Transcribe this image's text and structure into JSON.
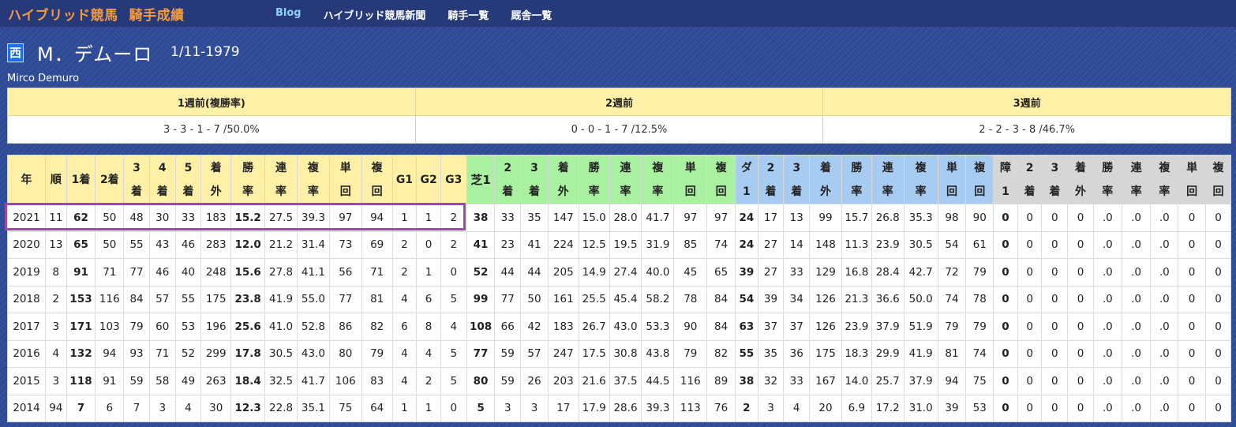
{
  "header": {
    "brand_main": "ハイブリッド競馬",
    "brand_sub": "騎手成績",
    "nav": [
      "Blog",
      "ハイブリッド競馬新聞",
      "騎手一覧",
      "厩舎一覧"
    ]
  },
  "jockey": {
    "affiliation": "西",
    "name": "M．デムーロ",
    "dob": "1/11-1979",
    "name_roman": "Mirco Demuro"
  },
  "recent_weeks": {
    "headers": [
      "1週前(複勝率)",
      "2週前",
      "3週前"
    ],
    "values": [
      "3 - 3 - 1 - 7 /50.0%",
      "0 - 0 - 1 - 7 /12.5%",
      "2 - 2 - 3 - 8 /46.7%"
    ]
  },
  "stats_table": {
    "headers": [
      [
        "年"
      ],
      [
        "順"
      ],
      [
        "1着"
      ],
      [
        "2着"
      ],
      [
        "3",
        "着"
      ],
      [
        "4",
        "着"
      ],
      [
        "5",
        "着"
      ],
      [
        "着",
        "外"
      ],
      [
        "勝",
        "率"
      ],
      [
        "連",
        "率"
      ],
      [
        "複",
        "率"
      ],
      [
        "単",
        "回"
      ],
      [
        "複",
        "回"
      ],
      [
        "G1"
      ],
      [
        "G2"
      ],
      [
        "G3"
      ],
      [
        "芝1"
      ],
      [
        "2",
        "着"
      ],
      [
        "3",
        "着"
      ],
      [
        "着",
        "外"
      ],
      [
        "勝",
        "率"
      ],
      [
        "連",
        "率"
      ],
      [
        "複",
        "率"
      ],
      [
        "単",
        "回"
      ],
      [
        "複",
        "回"
      ],
      [
        "ダ",
        "1"
      ],
      [
        "2",
        "着"
      ],
      [
        "3",
        "着"
      ],
      [
        "着",
        "外"
      ],
      [
        "勝",
        "率"
      ],
      [
        "連",
        "率"
      ],
      [
        "複",
        "率"
      ],
      [
        "単",
        "回"
      ],
      [
        "複",
        "回"
      ],
      [
        "障",
        "1"
      ],
      [
        "2",
        "着"
      ],
      [
        "3",
        "着"
      ],
      [
        "着",
        "外"
      ],
      [
        "勝",
        "率"
      ],
      [
        "連",
        "率"
      ],
      [
        "複",
        "率"
      ],
      [
        "単",
        "回"
      ],
      [
        "複",
        "回"
      ]
    ],
    "rows": [
      [
        "2021",
        "11",
        "62",
        "50",
        "48",
        "30",
        "33",
        "183",
        "15.2",
        "27.5",
        "39.3",
        "97",
        "94",
        "1",
        "1",
        "2",
        "38",
        "33",
        "35",
        "147",
        "15.0",
        "28.0",
        "41.7",
        "97",
        "97",
        "24",
        "17",
        "13",
        "99",
        "15.7",
        "26.8",
        "35.3",
        "98",
        "90",
        "0",
        "0",
        "0",
        "0",
        ".0",
        ".0",
        ".0",
        "0",
        "0"
      ],
      [
        "2020",
        "13",
        "65",
        "50",
        "55",
        "43",
        "46",
        "283",
        "12.0",
        "21.2",
        "31.4",
        "73",
        "69",
        "2",
        "0",
        "2",
        "41",
        "23",
        "41",
        "224",
        "12.5",
        "19.5",
        "31.9",
        "85",
        "74",
        "24",
        "27",
        "14",
        "148",
        "11.3",
        "23.9",
        "30.5",
        "54",
        "61",
        "0",
        "0",
        "0",
        "0",
        ".0",
        ".0",
        ".0",
        "0",
        "0"
      ],
      [
        "2019",
        "8",
        "91",
        "71",
        "77",
        "46",
        "40",
        "248",
        "15.6",
        "27.8",
        "41.1",
        "56",
        "71",
        "2",
        "1",
        "0",
        "52",
        "44",
        "44",
        "205",
        "14.9",
        "27.4",
        "40.0",
        "45",
        "65",
        "39",
        "27",
        "33",
        "129",
        "16.8",
        "28.4",
        "42.7",
        "72",
        "79",
        "0",
        "0",
        "0",
        "0",
        ".0",
        ".0",
        ".0",
        "0",
        "0"
      ],
      [
        "2018",
        "2",
        "153",
        "116",
        "84",
        "57",
        "55",
        "175",
        "23.8",
        "41.9",
        "55.0",
        "77",
        "81",
        "4",
        "6",
        "5",
        "99",
        "77",
        "50",
        "161",
        "25.5",
        "45.4",
        "58.2",
        "78",
        "84",
        "54",
        "39",
        "34",
        "126",
        "21.3",
        "36.6",
        "50.0",
        "74",
        "78",
        "0",
        "0",
        "0",
        "0",
        ".0",
        ".0",
        ".0",
        "0",
        "0"
      ],
      [
        "2017",
        "3",
        "171",
        "103",
        "79",
        "60",
        "53",
        "196",
        "25.6",
        "41.0",
        "52.8",
        "86",
        "82",
        "6",
        "8",
        "4",
        "108",
        "66",
        "42",
        "183",
        "26.7",
        "43.0",
        "53.3",
        "90",
        "84",
        "63",
        "37",
        "37",
        "126",
        "23.9",
        "37.9",
        "51.9",
        "79",
        "79",
        "0",
        "0",
        "0",
        "0",
        ".0",
        ".0",
        ".0",
        "0",
        "0"
      ],
      [
        "2016",
        "4",
        "132",
        "94",
        "93",
        "71",
        "52",
        "299",
        "17.8",
        "30.5",
        "43.0",
        "80",
        "79",
        "4",
        "4",
        "5",
        "77",
        "59",
        "57",
        "247",
        "17.5",
        "30.8",
        "43.8",
        "79",
        "82",
        "55",
        "35",
        "36",
        "175",
        "18.3",
        "29.9",
        "41.9",
        "81",
        "74",
        "0",
        "0",
        "0",
        "0",
        ".0",
        ".0",
        ".0",
        "0",
        "0"
      ],
      [
        "2015",
        "3",
        "118",
        "91",
        "59",
        "58",
        "49",
        "263",
        "18.4",
        "32.5",
        "41.7",
        "106",
        "83",
        "4",
        "2",
        "5",
        "80",
        "59",
        "26",
        "203",
        "21.6",
        "37.5",
        "44.5",
        "116",
        "89",
        "38",
        "32",
        "33",
        "167",
        "14.0",
        "25.7",
        "37.9",
        "94",
        "75",
        "0",
        "0",
        "0",
        "0",
        ".0",
        ".0",
        ".0",
        "0",
        "0"
      ],
      [
        "2014",
        "94",
        "7",
        "6",
        "7",
        "3",
        "4",
        "30",
        "12.3",
        "22.8",
        "35.1",
        "75",
        "64",
        "1",
        "1",
        "0",
        "5",
        "3",
        "3",
        "17",
        "17.9",
        "28.6",
        "39.3",
        "113",
        "76",
        "2",
        "3",
        "4",
        "20",
        "6.9",
        "17.2",
        "31.0",
        "39",
        "53",
        "0",
        "0",
        "0",
        "0",
        ".0",
        ".0",
        ".0",
        "0",
        "0"
      ]
    ]
  },
  "colors": {
    "background": "#2e4b9a",
    "brand": "#f59a3e",
    "header_yellow": "#fff0a8",
    "header_green": "#a9f0a0",
    "header_blue": "#a8cbf2",
    "header_gray": "#d6d6d6",
    "highlight": "#9b4aa8"
  }
}
